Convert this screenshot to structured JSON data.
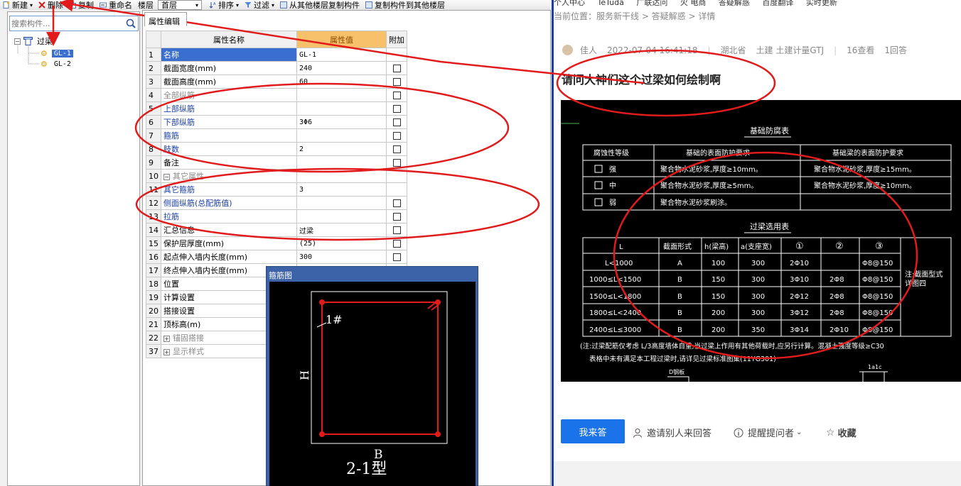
{
  "toolbar": {
    "new_label": "新建",
    "delete_label": "删除",
    "copy_label": "复制",
    "rename_label": "重命名",
    "floor_label": "楼层",
    "floor_value": "首层",
    "sort_label": "排序",
    "filter_label": "过滤",
    "copy_from_label": "从其他楼层复制构件",
    "copy_to_label": "复制构件到其他楼层",
    "more_label": "»"
  },
  "tree": {
    "search_placeholder": "搜索构件...",
    "root_label": "过梁",
    "items": [
      "GL-1",
      "GL-2"
    ]
  },
  "props": {
    "tab_label": "属性编辑",
    "col_name": "属性名称",
    "col_value": "属性值",
    "col_add": "附加",
    "rows": [
      {
        "num": "1",
        "name": "名称",
        "value": "GL-1"
      },
      {
        "num": "2",
        "name": "截面宽度(mm)",
        "value": "240"
      },
      {
        "num": "3",
        "name": "截面高度(mm)",
        "value": "60"
      },
      {
        "num": "4",
        "name": "全部纵筋",
        "value": ""
      },
      {
        "num": "5",
        "name": "上部纵筋",
        "value": ""
      },
      {
        "num": "6",
        "name": "下部纵筋",
        "value": "3Φ6"
      },
      {
        "num": "7",
        "name": "箍筋",
        "value": ""
      },
      {
        "num": "8",
        "name": "肢数",
        "value": "2"
      },
      {
        "num": "9",
        "name": "备注",
        "value": ""
      },
      {
        "num": "10",
        "name": "其它属性",
        "value": ""
      },
      {
        "num": "11",
        "name": "其它箍筋",
        "value": "3"
      },
      {
        "num": "12",
        "name": "侧面纵筋(总配筋值)",
        "value": ""
      },
      {
        "num": "13",
        "name": "拉筋",
        "value": ""
      },
      {
        "num": "14",
        "name": "汇总信息",
        "value": "过梁"
      },
      {
        "num": "15",
        "name": "保护层厚度(mm)",
        "value": "(25)"
      },
      {
        "num": "16",
        "name": "起点伸入墙内长度(mm)",
        "value": "300"
      },
      {
        "num": "17",
        "name": "终点伸入墙内长度(mm)",
        "value": ""
      },
      {
        "num": "18",
        "name": "位置",
        "value": ""
      },
      {
        "num": "19",
        "name": "计算设置",
        "value": ""
      },
      {
        "num": "20",
        "name": "搭接设置",
        "value": ""
      },
      {
        "num": "21",
        "name": "顶标高(m)",
        "value": ""
      },
      {
        "num": "22",
        "name": "锚固搭接",
        "value": ""
      },
      {
        "num": "37",
        "name": "显示样式",
        "value": ""
      }
    ]
  },
  "stirrup": {
    "title": "箍筋图",
    "label_1": "1#",
    "label_h": "H",
    "label_b": "B",
    "type_label": "2-1型"
  },
  "web": {
    "bookmarks": [
      "个人中心",
      "TeTuda",
      "广联达问",
      "火 电商",
      "答疑解惑",
      "百度翻译",
      "实时更新"
    ],
    "breadcrumb": "当前位置：服务新干线 > 答疑解惑 > 详情",
    "author": "佳人",
    "date": "2022-07-04 16:41:18",
    "location": "湖北省",
    "tags": "土建 土建计量GTJ",
    "views": "16查看",
    "answers": "1回答",
    "question_title": "请问大神们这个过梁如何绘制啊",
    "answer_button": "我来答",
    "invite_label": "邀请别人来回答",
    "remind_label": "提醒提问者",
    "collect_label": "收藏"
  },
  "cad": {
    "table1_title": "基础防腐表",
    "table1_headers": [
      "腐蚀性等级",
      "基础的表面防护要求",
      "基础梁的表面防护要求"
    ],
    "table1_rows": [
      [
        "强",
        "聚合物水泥砂浆,厚度≥10mm。",
        "聚合物水泥砂浆,厚度≥15mm。"
      ],
      [
        "中",
        "聚合物水泥砂浆,厚度≥5mm。",
        "聚合物水泥砂浆,厚度≥10mm。"
      ],
      [
        "弱",
        "聚合物水泥砂浆刷涂。",
        ""
      ]
    ],
    "table2_title": "过梁选用表",
    "table2_headers": [
      "L",
      "截面形式",
      "h(梁高)",
      "a(支座宽)",
      "①",
      "②",
      "③"
    ],
    "table2_rows": [
      [
        "L<1000",
        "A",
        "100",
        "300",
        "2Φ10",
        "",
        "Φ8@150"
      ],
      [
        "1000≤L<1500",
        "B",
        "150",
        "300",
        "3Φ10",
        "2Φ8",
        "Φ8@150"
      ],
      [
        "1500≤L<1800",
        "B",
        "150",
        "300",
        "2Φ12",
        "2Φ8",
        "Φ8@150"
      ],
      [
        "1800≤L<2400",
        "B",
        "200",
        "300",
        "3Φ12",
        "2Φ8",
        "Φ8@150"
      ],
      [
        "2400≤L≤3000",
        "B",
        "200",
        "350",
        "3Φ14",
        "2Φ10",
        "Φ8@150"
      ]
    ],
    "side_note": "注:截面型式详图四",
    "note_line1": "(注:过梁配筋仅考虑 L/3高度墙体自重,当过梁上作用有其他荷载时,应另行计算。混凝土强度等级≥C30",
    "note_line2": "表格中未有满足本工程过梁时,请详见过梁标准图集(11YG301)",
    "bottom_label_1": "D钢板",
    "bottom_label_2": "1a1c"
  },
  "colors": {
    "annotation": "#e11b1b",
    "selected": "#3a6fd0",
    "value_header": "#f7c06a",
    "primary_button": "#1a73e8",
    "divider": "#1b3fa8"
  }
}
